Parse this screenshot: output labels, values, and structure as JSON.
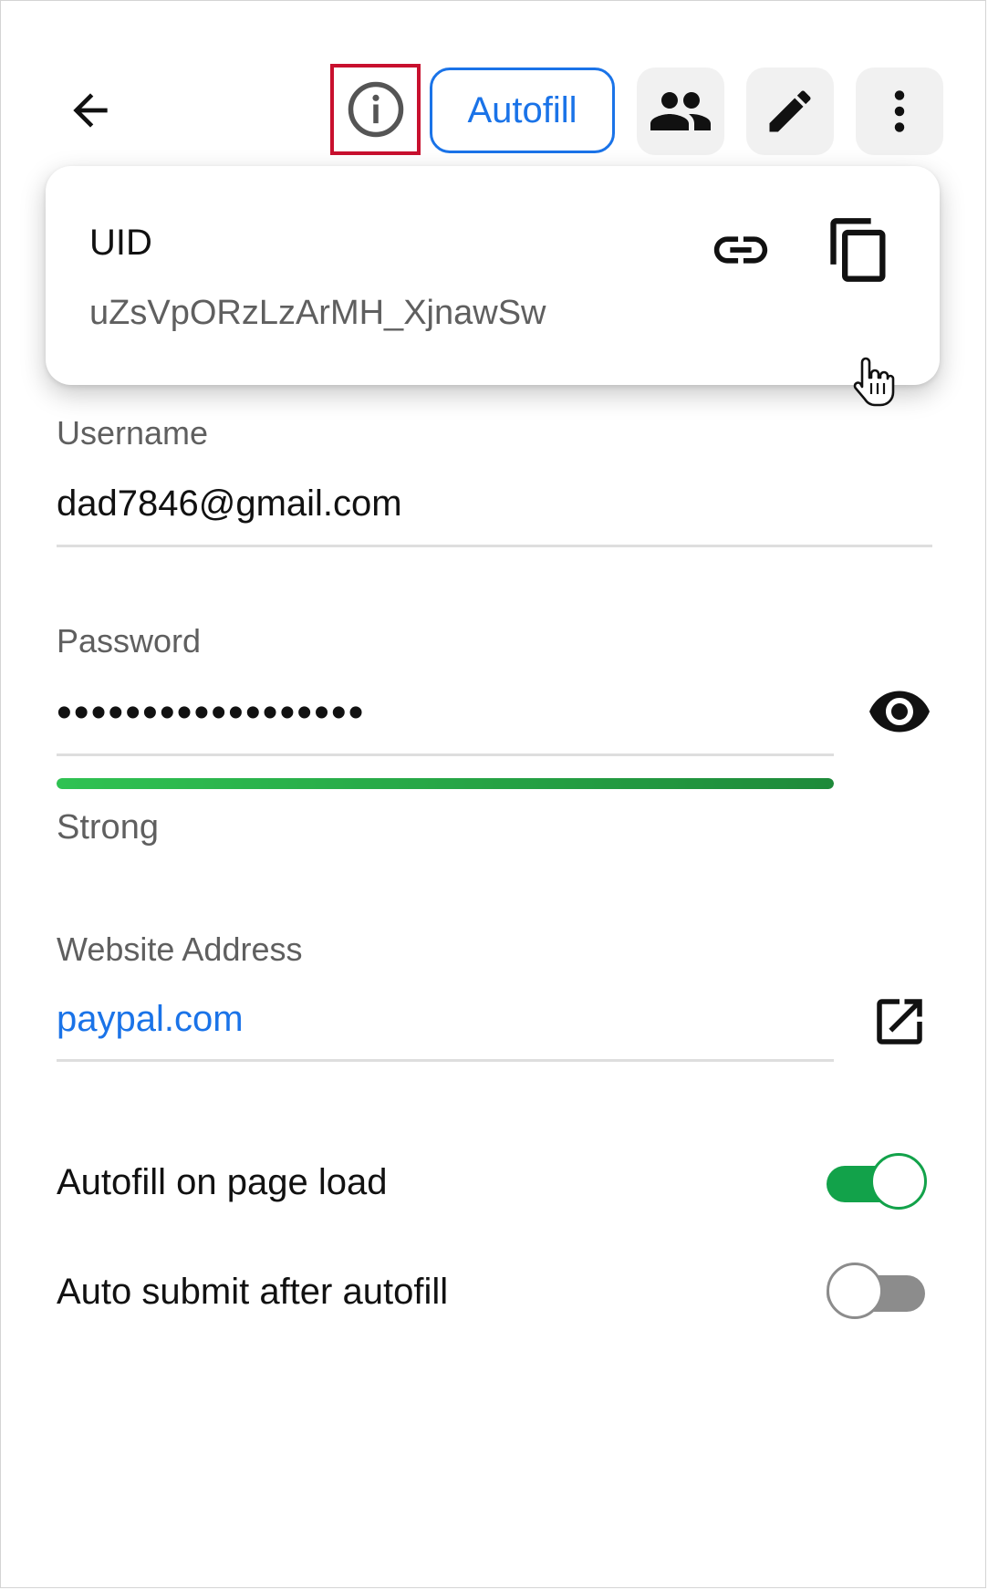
{
  "header": {
    "back_icon": "arrow-left-icon",
    "info_icon": "info-circle-icon",
    "autofill_label": "Autofill",
    "share_icon": "people-icon",
    "edit_icon": "pencil-icon",
    "more_icon": "more-vertical-icon"
  },
  "uid_popover": {
    "title": "UID",
    "value": "uZsVpORzLzArMH_XjnawSw",
    "link_icon": "link-icon",
    "copy_icon": "copy-icon"
  },
  "fields": {
    "username": {
      "label": "Username",
      "value": "dad7846@gmail.com"
    },
    "password": {
      "label": "Password",
      "value": "••••••••••••••••••",
      "toggle_visibility_icon": "eye-icon",
      "strength_label": "Strong",
      "strength_fraction": 1.0
    },
    "website": {
      "label": "Website Address",
      "value": "paypal.com",
      "open_icon": "open-external-icon"
    }
  },
  "toggles": [
    {
      "label": "Autofill on page load",
      "on": true
    },
    {
      "label": "Auto submit after autofill",
      "on": false
    }
  ],
  "colors": {
    "accent": "#1a73e8",
    "highlight_border": "#c8102e",
    "toggle_on": "#12a24a",
    "toggle_off": "#8c8c8c"
  }
}
